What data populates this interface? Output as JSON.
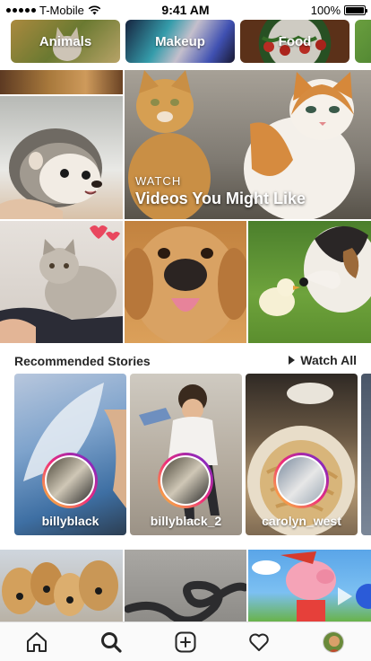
{
  "status_bar": {
    "carrier": "T-Mobile",
    "time": "9:41 AM",
    "battery": "100%",
    "battery_level": 1.0
  },
  "topics": [
    {
      "label": "Animals"
    },
    {
      "label": "Makeup"
    },
    {
      "label": "Food"
    },
    {
      "label": ""
    }
  ],
  "watch": {
    "kicker": "WATCH",
    "headline": "Videos You Might Like"
  },
  "stories": {
    "title": "Recommended Stories",
    "watch_all": "Watch All",
    "items": [
      {
        "username": "billyblack"
      },
      {
        "username": "billyblack_2"
      },
      {
        "username": "carolyn_west"
      }
    ]
  },
  "tabbar": {
    "icons": [
      "home-icon",
      "search-icon",
      "add-post-icon",
      "heart-icon",
      "profile-avatar"
    ]
  },
  "colors": {
    "story_ring_start": "#f9ce34",
    "story_ring_mid": "#ee2a7b",
    "story_ring_end": "#6228d7",
    "text_primary": "#262626"
  }
}
